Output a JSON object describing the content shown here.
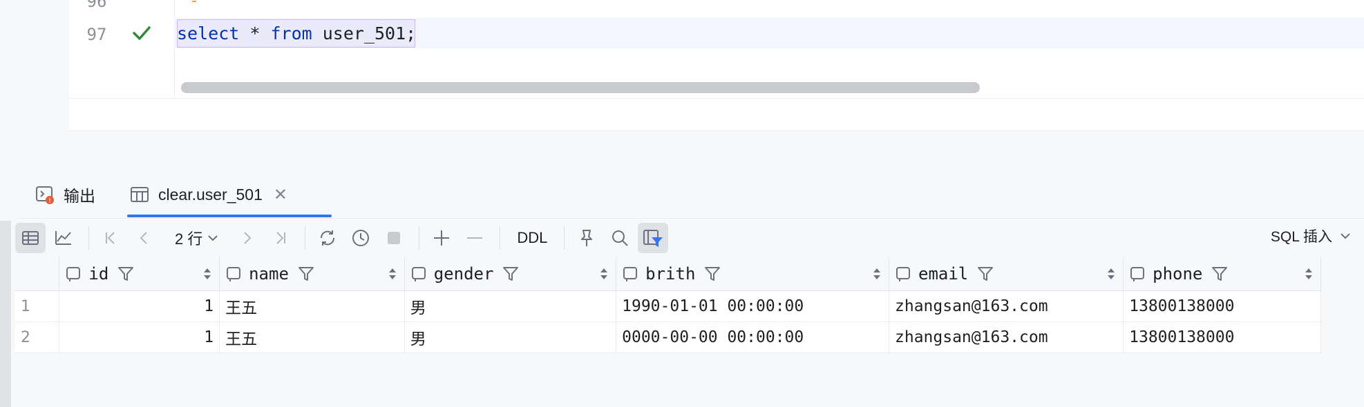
{
  "editor": {
    "line_numbers": [
      "96",
      "97"
    ],
    "code": {
      "kw_select": "select",
      "star": " * ",
      "kw_from": "from",
      "space": " ",
      "table": "user_501",
      "semicolon": ";"
    }
  },
  "tabs": [
    {
      "label": "输出",
      "icon": "console-output-icon"
    },
    {
      "label": "clear.user_501",
      "icon": "table-icon"
    }
  ],
  "toolbar": {
    "rows_label": "2 行",
    "ddl_label": "DDL",
    "sql_insert_label": "SQL 插入"
  },
  "grid": {
    "columns": [
      "id",
      "name",
      "gender",
      "brith",
      "email",
      "phone"
    ],
    "rows": [
      {
        "num": "1",
        "id": "1",
        "name": "王五",
        "gender": "男",
        "brith": "1990-01-01 00:00:00",
        "email": "zhangsan@163.com",
        "phone": "13800138000"
      },
      {
        "num": "2",
        "id": "1",
        "name": "王五",
        "gender": "男",
        "brith": "0000-00-00 00:00:00",
        "email": "zhangsan@163.com",
        "phone": "13800138000"
      }
    ]
  },
  "colors": {
    "keyword": "#0033b3",
    "success_check": "#2e8b3a",
    "tab_underline": "#3574f0"
  }
}
